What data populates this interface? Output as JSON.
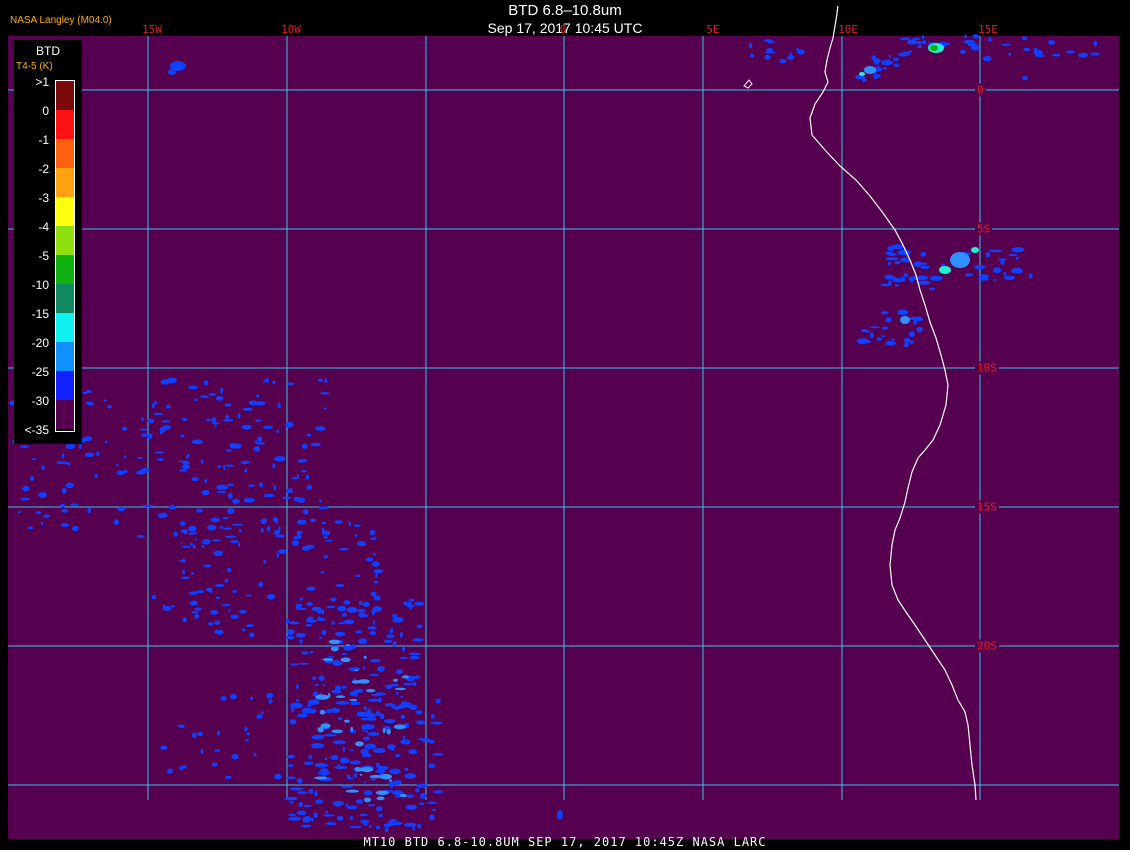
{
  "header": {
    "agency": "NASA Langley (M04.0)",
    "title": "BTD 6.8–10.8um",
    "subtitle": "Sep 17, 2017 10:45 UTC"
  },
  "legend": {
    "title": "BTD",
    "units": "T4-5 (K)",
    "ticks": [
      ">1",
      "0",
      "-1",
      "-2",
      "-3",
      "-4",
      "-5",
      "-10",
      "-15",
      "-20",
      "-25",
      "-30",
      "<-35"
    ],
    "colors": [
      "#7a0a0a",
      "#ff1010",
      "#ff6010",
      "#ffa010",
      "#ffff10",
      "#90e010",
      "#10b010",
      "#108860",
      "#10f0f0",
      "#1090ff",
      "#1020ff",
      "#560050"
    ]
  },
  "longitude_labels": [
    "15W",
    "10W",
    "0",
    "5E",
    "10E",
    "15E"
  ],
  "latitude_labels": [
    "0",
    "5S",
    "10S",
    "15S",
    "20S"
  ],
  "colors": {
    "background": "#560050",
    "grid": "#30c8e0",
    "coast": "#ffffff",
    "cloud_light": "#1040ff",
    "cloud_mid": "#3090ff",
    "cloud_cyan": "#20f0d0"
  },
  "footer": "MT10  BTD 6.8-10.8UM  SEP 17, 2017 10:45Z  NASA LARC"
}
